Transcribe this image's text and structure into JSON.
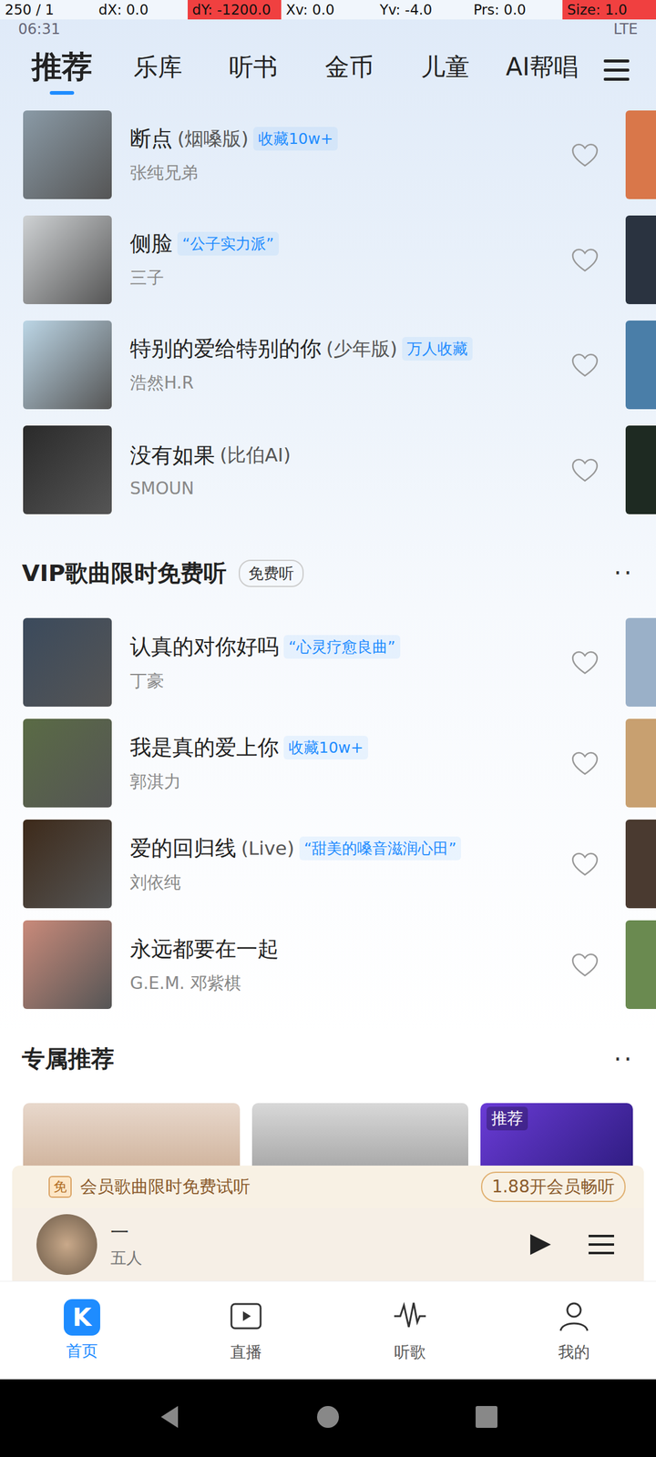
{
  "debug_bar": [
    {
      "text": "250 / 1",
      "alert": false
    },
    {
      "text": "dX: 0.0",
      "alert": false
    },
    {
      "text": "dY: -1200.0",
      "alert": true
    },
    {
      "text": "Xv: 0.0",
      "alert": false
    },
    {
      "text": "Yv: -4.0",
      "alert": false
    },
    {
      "text": "Prs: 0.0",
      "alert": false
    },
    {
      "text": "Size: 1.0",
      "alert": true
    }
  ],
  "status_bar": {
    "time": "06:31",
    "network": "LTE"
  },
  "tabs": [
    {
      "label": "推荐",
      "selected": true
    },
    {
      "label": "乐库",
      "selected": false
    },
    {
      "label": "听书",
      "selected": false
    },
    {
      "label": "金币",
      "selected": false
    },
    {
      "label": "儿童",
      "selected": false
    },
    {
      "label": "AI帮唱",
      "selected": false
    }
  ],
  "recommend_songs": [
    {
      "title": "断点",
      "version": "(烟嗓版)",
      "tag": "收藏10w+",
      "artist": "张纯兄弟",
      "liked": false
    },
    {
      "title": "侧脸",
      "version": "",
      "tag": "“公子实力派”",
      "artist": "三子",
      "liked": false
    },
    {
      "title": "特别的爱给特别的你",
      "version": "(少年版)",
      "tag": "万人收藏",
      "artist": "浩然H.R",
      "liked": false
    },
    {
      "title": "没有如果",
      "version": "(比伯AI)",
      "tag": "",
      "artist": "SMOUN",
      "liked": false
    }
  ],
  "vip_section": {
    "title": "VIP歌曲限时免费听",
    "badge": "免费听",
    "more": "··",
    "songs": [
      {
        "title": "认真的对你好吗",
        "version": "",
        "tag": "“心灵疗愈良曲”",
        "artist": "丁豪",
        "liked": false
      },
      {
        "title": "我是真的爱上你",
        "version": "",
        "tag": "收藏10w+",
        "artist": "郭淇力",
        "liked": false
      },
      {
        "title": "爱的回归线",
        "version": "(Live)",
        "tag": "“甜美的嗓音滋润心田”",
        "artist": "刘依纯",
        "liked": false
      },
      {
        "title": "永远都要在一起",
        "version": "",
        "tag": "",
        "artist": "G.E.M. 邓紫棋",
        "liked": false
      }
    ]
  },
  "exclusive": {
    "title": "专属推荐",
    "more": "··",
    "cards": [
      {
        "tag": ""
      },
      {
        "tag": ""
      },
      {
        "tag": "推荐"
      }
    ]
  },
  "member_banner": {
    "icon": "免",
    "text": "会员歌曲限时免费试听",
    "button": "1.88开会员畅听"
  },
  "mini_player": {
    "title": "一",
    "subtitle": "五人",
    "playing": false
  },
  "bottom_nav": [
    {
      "label": "首页",
      "selected": true,
      "kind": "home",
      "logo": "K"
    },
    {
      "label": "直播",
      "selected": false,
      "kind": "live",
      "logo": ""
    },
    {
      "label": "听歌",
      "selected": false,
      "kind": "listen",
      "logo": ""
    },
    {
      "label": "我的",
      "selected": false,
      "kind": "mine",
      "logo": ""
    }
  ]
}
